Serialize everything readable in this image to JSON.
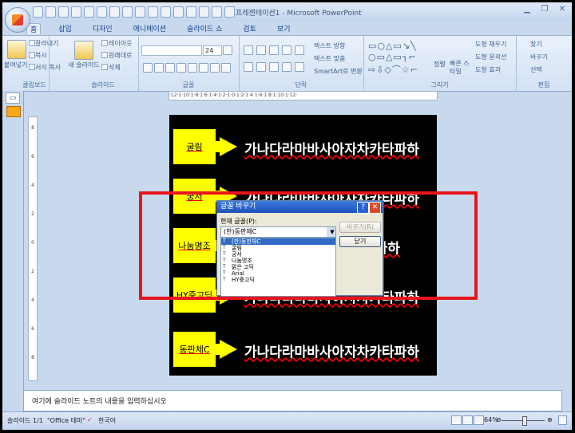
{
  "window": {
    "title": "프레젠테이션1 - Microsoft PowerPoint"
  },
  "tabs": [
    "홈",
    "삽입",
    "디자인",
    "애니메이션",
    "슬라이드 쇼",
    "검토",
    "보기"
  ],
  "ribbon": {
    "clipboard": {
      "paste": "붙여넣기",
      "cut": "잘라내기",
      "copy": "복사",
      "format_copy": "서식 복사",
      "label": "클립보드"
    },
    "slides": {
      "new_slide": "새 슬라이드",
      "layout": "레이아웃",
      "reset": "원래대로",
      "delete": "삭제",
      "label": "슬라이드"
    },
    "font": {
      "size": "24",
      "label": "글꼴"
    },
    "paragraph": {
      "text_direction": "텍스트 방향",
      "align_text": "텍스트 맞춤",
      "smartart": "SmartArt로 변환",
      "label": "단락"
    },
    "drawing": {
      "arrange": "정렬",
      "quick_styles": "빠른 스타일",
      "shape_fill": "도형 채우기",
      "shape_outline": "도형 윤곽선",
      "shape_effects": "도형 효과",
      "label": "그리기"
    },
    "editing": {
      "find": "찾기",
      "replace": "바꾸기",
      "select": "선택",
      "label": "편집"
    }
  },
  "ruler_text": "·12·1·10·1·8·1·6·1·4·1·2·1·0·1·2·1·4·1·6·1·8·1·10·1·12·",
  "vruler_marks": [
    "8",
    "6",
    "4",
    "2",
    "0",
    "2",
    "4",
    "6",
    "8"
  ],
  "slide": {
    "rows": [
      {
        "label": "굴림",
        "sample": "가나다라마바사아자차카타파하"
      },
      {
        "label": "궁서",
        "sample": "가나다라마바사아자차카타파하"
      },
      {
        "label": "나눔명조",
        "sample": "가나다라마바사아자차카타파하"
      },
      {
        "label": "HY중고딕",
        "sample": "가나다라마바사아자차카타파하"
      },
      {
        "label": "동판체C",
        "sample": "가나다라마바사아자차카타파하"
      }
    ],
    "visible_fragments": {
      "row3": "타파하"
    }
  },
  "dialog": {
    "title": "글꼴 바꾸기",
    "current_font_label": "현재 글꼴(P):",
    "current_font_value": "(한)동판체C",
    "replace_button": "바꾸기(R)",
    "close_button": "닫기",
    "font_list": [
      "(한)동판체C",
      "굴림",
      "궁서",
      "나눔명조",
      "맑은 고딕",
      "Arial",
      "HY중고딕"
    ],
    "selected_index": 0
  },
  "notes": {
    "placeholder": "여기에 슬라이드 노트의 내용을 입력하십시오"
  },
  "status": {
    "slide_counter": "슬라이드 1/1",
    "theme": "\"Office 테마\"",
    "language": "한국어",
    "zoom": "64%"
  },
  "colors": {
    "highlight": "#e8141b",
    "label_fill": "#ffff00",
    "slide_bg": "#000000",
    "selection": "#316ac5"
  }
}
